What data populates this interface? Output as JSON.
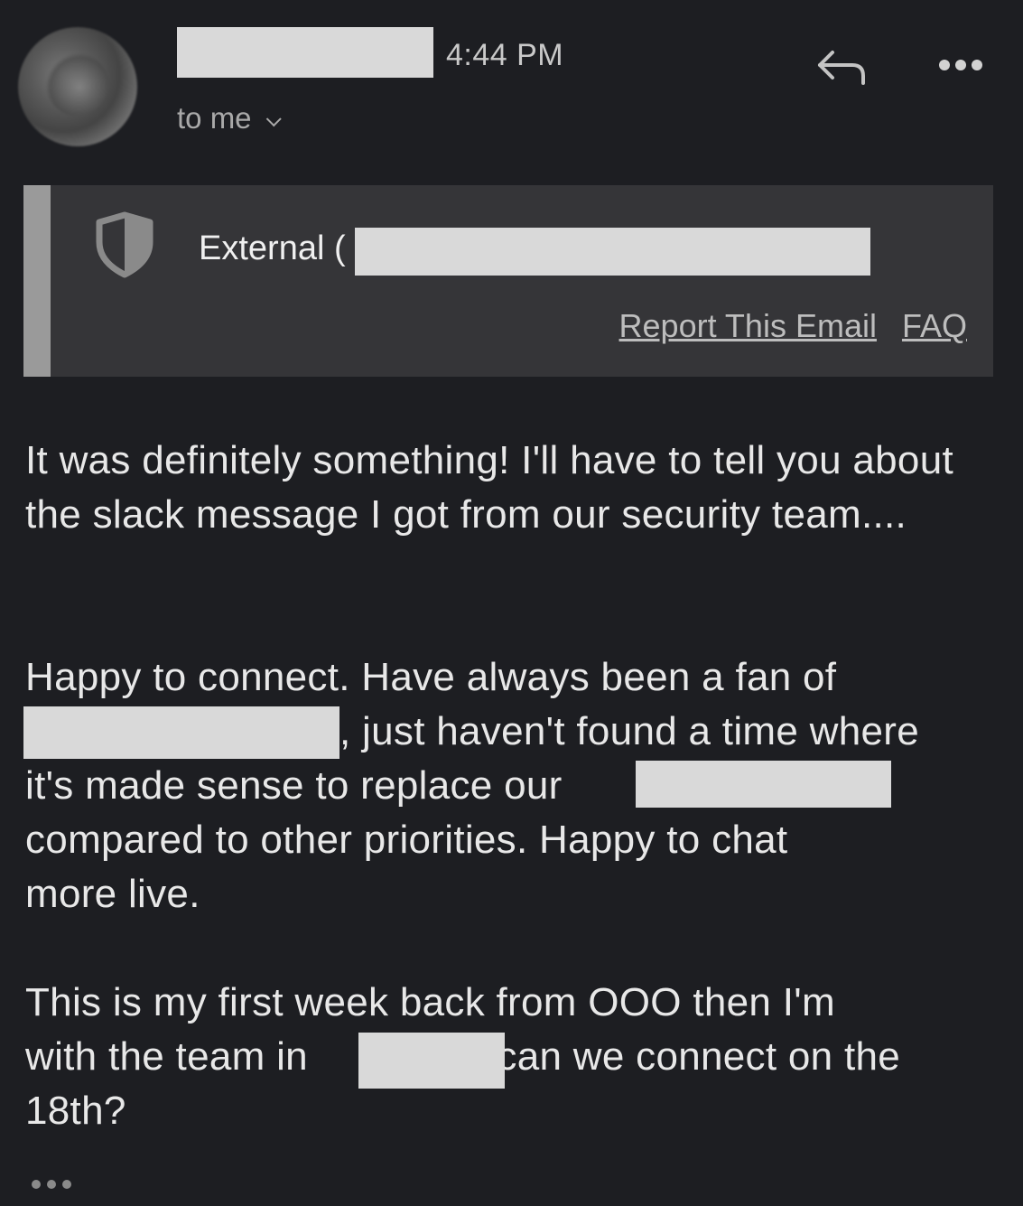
{
  "header": {
    "time": "4:44 PM",
    "recipient_label": "to me",
    "icons": {
      "avatar": "sender-avatar",
      "reply": "reply-icon",
      "more": "more-dots-icon",
      "chevron": "chevron-down-icon"
    }
  },
  "banner": {
    "external_label": "External (",
    "report_label": "Report This Email",
    "faq_label": "FAQ",
    "icon": "shield-icon"
  },
  "body": {
    "p1": "It was definitely something! I'll have to tell you about the slack message I got from our security team....",
    "p2_line1": "Happy to connect. Have always been a fan of",
    "p2_line2": ", just haven't found a time where",
    "p2_line3": "it's made sense to replace our",
    "p2_line4": "compared to other priorities. Happy to chat",
    "p2_line5": "more live.",
    "p3_line1": "This is my first week back from OOO then I'm",
    "p3_line2a": "with the team in",
    "p3_line2b": "- can we connect on the",
    "p3_line3": "18th?"
  },
  "colors": {
    "background": "#1d1e22",
    "banner_bg": "#353538",
    "banner_bar": "#9a9a9a",
    "redaction": "#d9d9d9"
  }
}
